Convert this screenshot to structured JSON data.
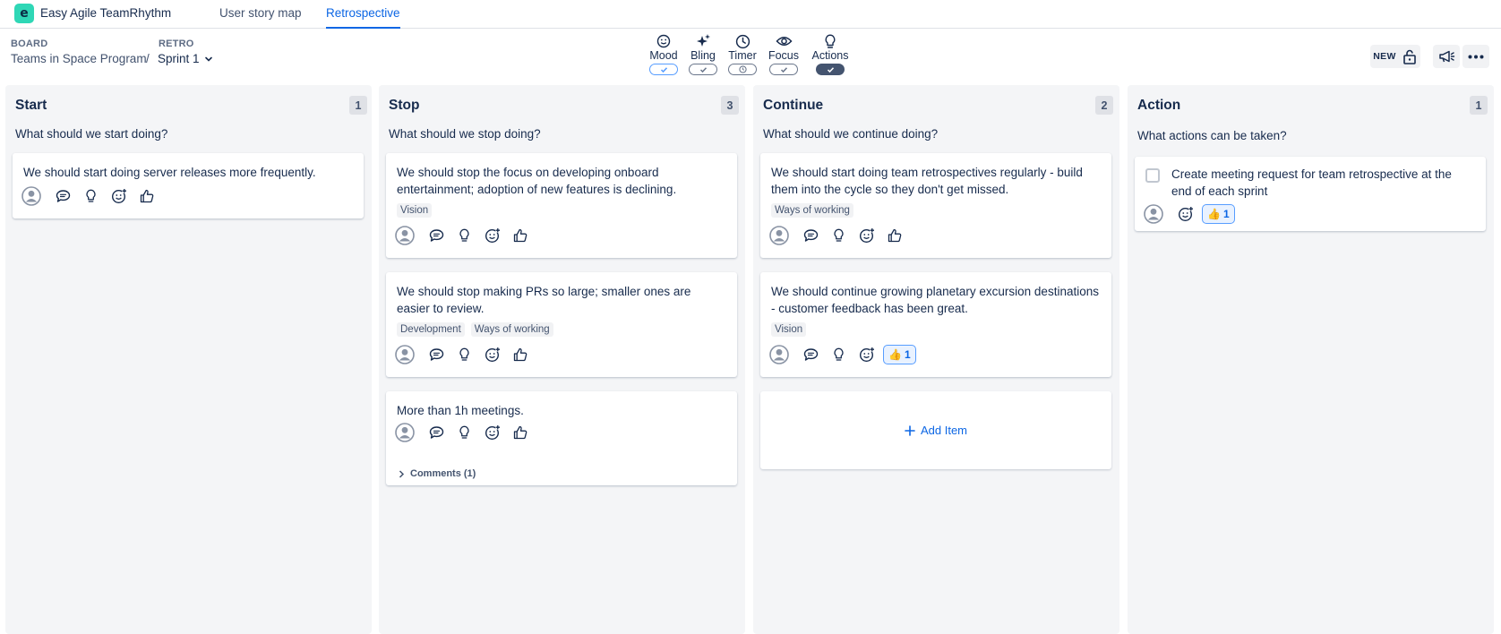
{
  "app": {
    "name": "Easy Agile TeamRhythm",
    "logo_letter": "e"
  },
  "tabs": [
    {
      "label": "User story map",
      "active": false
    },
    {
      "label": "Retrospective",
      "active": true
    }
  ],
  "breadcrumb": {
    "board_label": "BOARD",
    "board_value": "Teams in Space Program",
    "separator": "/",
    "retro_label": "RETRO",
    "retro_value": "Sprint 1"
  },
  "toolbar": [
    {
      "label": "Mood",
      "icon": "smiley-icon",
      "state": "on"
    },
    {
      "label": "Bling",
      "icon": "sparkle-icon",
      "state": "off"
    },
    {
      "label": "Timer",
      "icon": "clock-icon",
      "state": "off"
    },
    {
      "label": "Focus",
      "icon": "eye-icon",
      "state": "off"
    },
    {
      "label": "Actions",
      "icon": "lightbulb-icon",
      "state": "active"
    }
  ],
  "header_right": {
    "new_badge": "NEW"
  },
  "columns": [
    {
      "title": "Start",
      "count": "1",
      "prompt": "What should we start doing?",
      "cards": [
        {
          "text": "We should start doing server releases more frequently.",
          "tags": []
        }
      ]
    },
    {
      "title": "Stop",
      "count": "3",
      "prompt": "What should we stop doing?",
      "cards": [
        {
          "text": "We should stop the focus on developing onboard entertainment; adoption of new features is declining.",
          "tags": [
            "Vision"
          ]
        },
        {
          "text": "We should stop making PRs so large; smaller ones are easier to review.",
          "tags": [
            "Development",
            "Ways of working"
          ]
        },
        {
          "text": "More than 1h meetings.",
          "tags": [],
          "comments": "Comments (1)"
        }
      ]
    },
    {
      "title": "Continue",
      "count": "2",
      "prompt": "What should we continue doing?",
      "cards": [
        {
          "text": "We should start doing team retrospectives regularly - build them into the cycle so they don't get missed.",
          "tags": [
            "Ways of working"
          ]
        },
        {
          "text": "We should continue growing planetary excursion destinations - customer feedback has been great.",
          "tags": [
            "Vision"
          ],
          "reaction": {
            "emoji": "👍",
            "count": "1"
          }
        }
      ],
      "add_item": "Add Item"
    },
    {
      "title": "Action",
      "count": "1",
      "prompt": "What actions can be taken?",
      "cards": [
        {
          "text": "Create meeting request for team retrospective at the end of each sprint",
          "checked": false,
          "reaction": {
            "emoji": "👍",
            "count": "1"
          }
        }
      ]
    }
  ],
  "colors": {
    "accent": "#0c66e4",
    "column_bg": "#f4f5f7",
    "logo": "#2fd7b6"
  }
}
